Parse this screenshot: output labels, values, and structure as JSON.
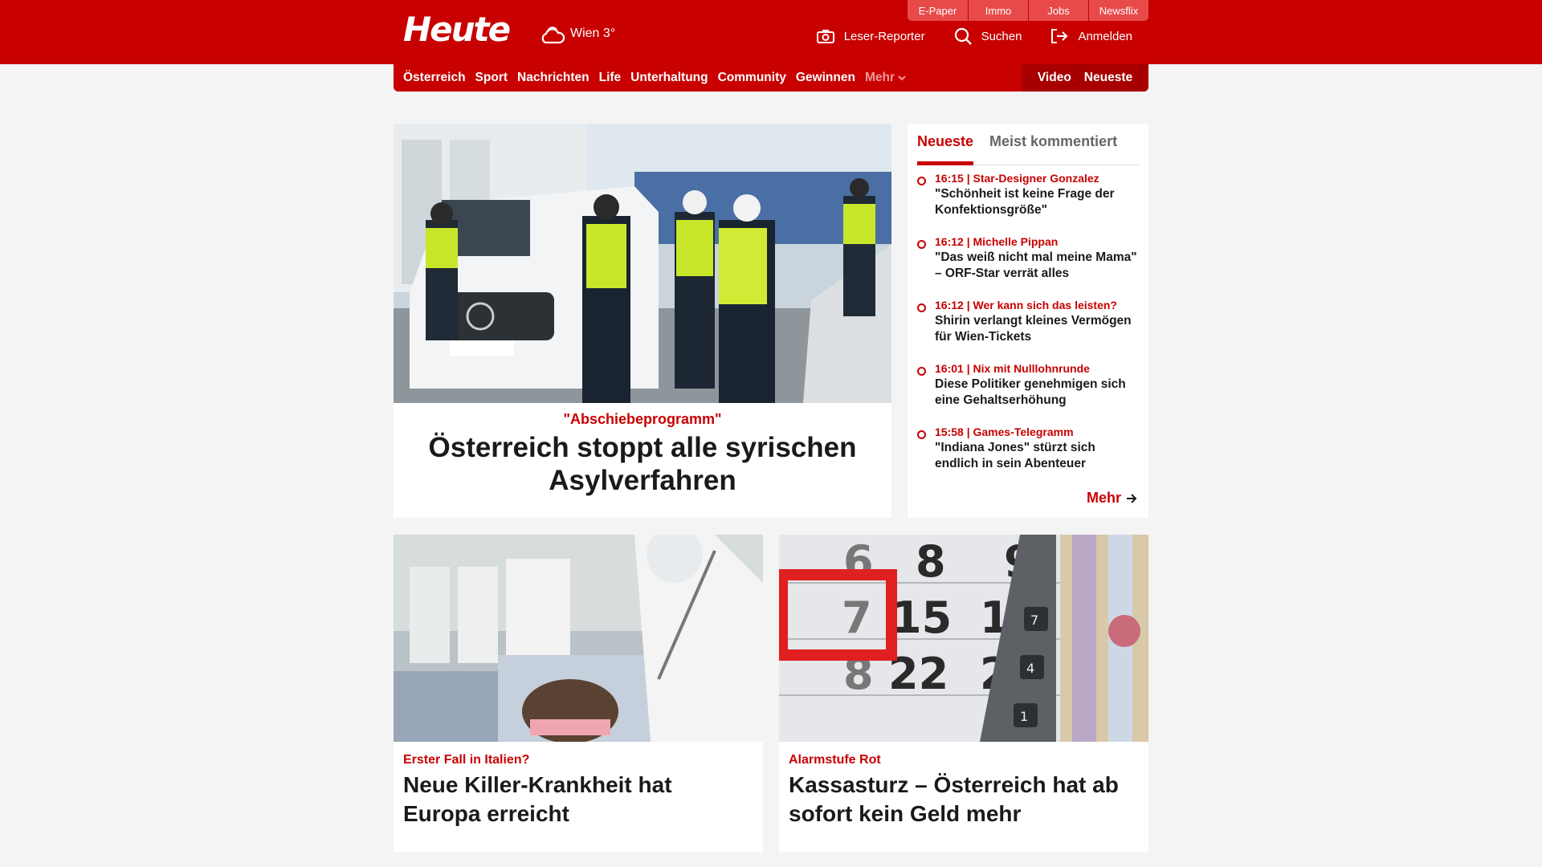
{
  "header": {
    "logo": "Heute",
    "weather": "Wien 3°",
    "top_tabs": [
      "E-Paper",
      "Immo",
      "Jobs",
      "Newsflix"
    ],
    "actions": {
      "reporter": "Leser-Reporter",
      "search": "Suchen",
      "login": "Anmelden"
    }
  },
  "nav": {
    "items": [
      "Österreich",
      "Sport",
      "Nachrichten",
      "Life",
      "Unterhaltung",
      "Community",
      "Gewinnen"
    ],
    "more": "Mehr",
    "video": "Video",
    "latest": "Neueste"
  },
  "hero": {
    "kicker": "\"Abschiebeprogramm\"",
    "title": "Österreich stoppt alle syrischen Asylverfahren"
  },
  "sidebar": {
    "tabs": [
      "Neueste",
      "Meist kommentiert"
    ],
    "items": [
      {
        "meta": "16:15 | Star-Designer Gonzalez",
        "title": "\"Schönheit ist keine Frage der Konfektionsgröße\""
      },
      {
        "meta": "16:12 | Michelle Pippan",
        "title": "\"Das weiß nicht mal meine Mama\" – ORF-Star verrät alles"
      },
      {
        "meta": "16:12 | Wer kann sich das leisten?",
        "title": "Shirin verlangt kleines Vermögen für Wien-Tickets"
      },
      {
        "meta": "16:01 | Nix mit Nulllohnrunde",
        "title": "Diese Politiker genehmigen sich eine Gehaltserhöhung"
      },
      {
        "meta": "15:58 | Games-Telegramm",
        "title": "\"Indiana Jones\" stürzt sich endlich in sein Abenteuer"
      }
    ],
    "more": "Mehr"
  },
  "cards": [
    {
      "kicker": "Erster Fall in Italien?",
      "title": "Neue Killer-Krankheit hat Europa erreicht"
    },
    {
      "kicker": "Alarmstufe Rot",
      "title": "Kassasturz – Österreich hat ab sofort kein Geld mehr"
    }
  ],
  "calendar": {
    "row1": [
      "6",
      "8",
      "9"
    ],
    "row2": [
      "7",
      "15",
      "16"
    ],
    "row3": [
      "8",
      "22",
      "2"
    ],
    "keys": [
      "7",
      "4",
      "1"
    ]
  }
}
